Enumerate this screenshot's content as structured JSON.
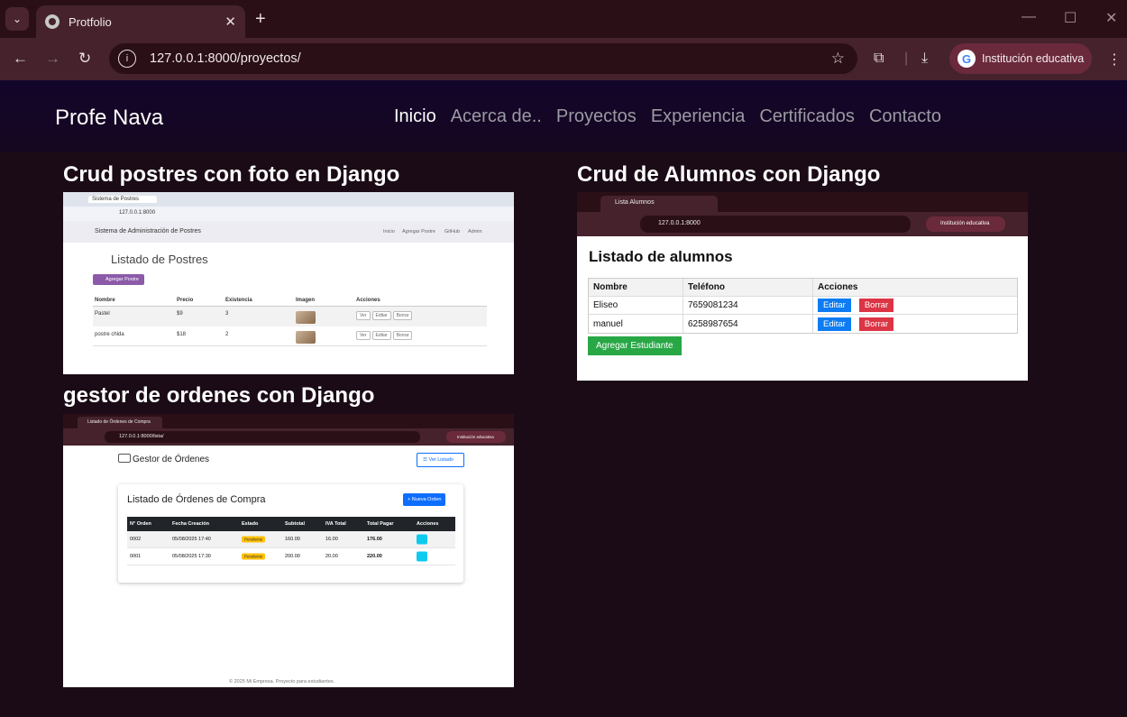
{
  "browser": {
    "tab_title": "Protfolio",
    "url": "127.0.0.1:8000/proyectos/",
    "profile_label": "Institución educativa"
  },
  "site": {
    "brand": "Profe Nava",
    "nav": [
      {
        "label": "Inicio",
        "active": true
      },
      {
        "label": "Acerca de..",
        "active": false
      },
      {
        "label": "Proyectos",
        "active": false
      },
      {
        "label": "Experiencia",
        "active": false
      },
      {
        "label": "Certificados",
        "active": false
      },
      {
        "label": "Contacto",
        "active": false
      }
    ]
  },
  "projects": [
    {
      "title": "Crud postres con foto en Django",
      "shot": {
        "tab": "Sistema de Postres",
        "url": "127.0.0.1:8000",
        "app_title": "Sistema de Administración de Postres",
        "nav": [
          "Inicio",
          "Agregar Postre",
          "GitHub",
          "Admin"
        ],
        "heading": "Listado de Postres",
        "add_button": "Agregar Postre",
        "columns": [
          "Nombre",
          "Precio",
          "Existencia",
          "Imagen",
          "Acciones"
        ],
        "rows": [
          {
            "nombre": "Pastel",
            "precio": "$9",
            "existencia": "3"
          },
          {
            "nombre": "postre chida",
            "precio": "$18",
            "existencia": "2"
          }
        ],
        "actions": [
          "Ver",
          "Editar",
          "Borrar"
        ]
      }
    },
    {
      "title": "Crud de Alumnos con Django",
      "shot": {
        "tab": "Lista Alumnos",
        "url": "127.0.0.1:8000",
        "profile": "Institución educativa",
        "heading": "Listado de alumnos",
        "columns": [
          "Nombre",
          "Teléfono",
          "Acciones"
        ],
        "rows": [
          {
            "nombre": "Eliseo",
            "telefono": "7659081234"
          },
          {
            "nombre": "manuel",
            "telefono": "6258987654"
          }
        ],
        "edit_label": "Editar",
        "delete_label": "Borrar",
        "add_button": "Agregar Estudiante"
      }
    },
    {
      "title": "gestor de ordenes con Django",
      "shot": {
        "tab": "Listado de Órdenes de Compra",
        "url": "127.0.0.1:8000/lista/",
        "profile": "Institución educativa",
        "app_title": "Gestor de Órdenes",
        "list_button": "☰ Ver Listado",
        "heading": "Listado de Órdenes de Compra",
        "new_button": "+ Nueva Orden",
        "columns": [
          "N° Orden",
          "Fecha Creación",
          "Estado",
          "Subtotal",
          "IVA Total",
          "Total Pagar",
          "Acciones"
        ],
        "rows": [
          {
            "orden": "0002",
            "fecha": "05/08/2025 17:40",
            "estado": "Pendiente",
            "subtotal": "160.00",
            "iva": "16.00",
            "total": "176.00"
          },
          {
            "orden": "0001",
            "fecha": "05/08/2025 17:30",
            "estado": "Pendiente",
            "subtotal": "200.00",
            "iva": "20.00",
            "total": "220.00"
          }
        ],
        "footer": "© 2025 Mi Empresa. Proyecto para estudiantes."
      }
    }
  ]
}
